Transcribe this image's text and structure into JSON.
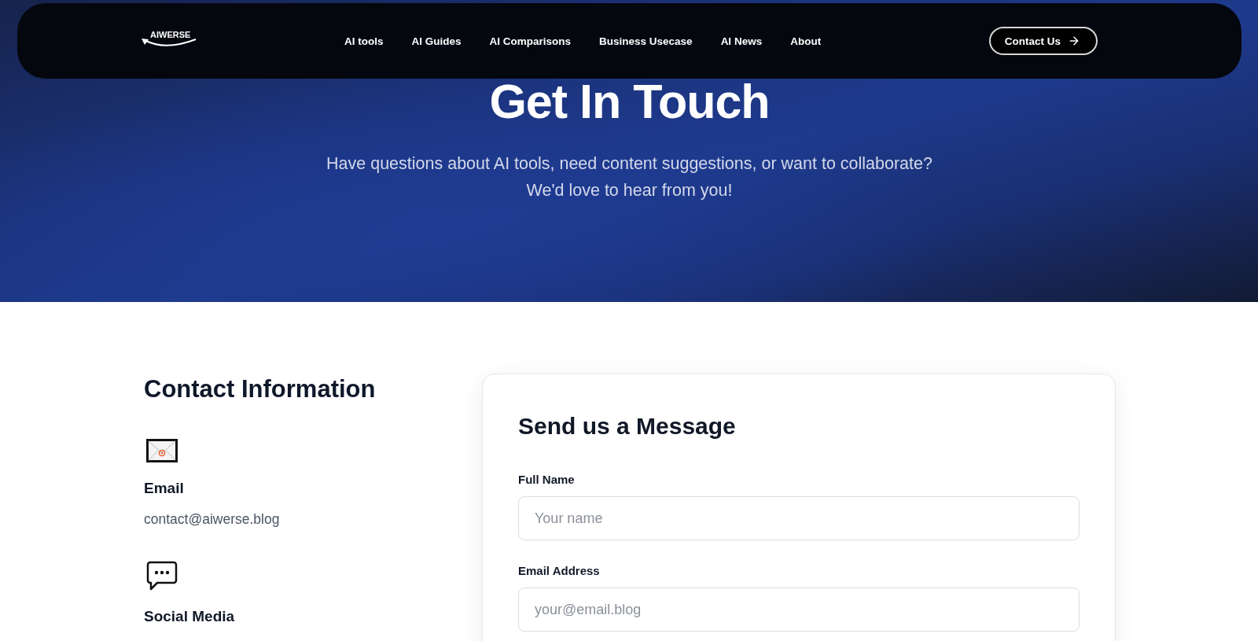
{
  "nav": {
    "logo": "AIWERSE",
    "links": [
      "AI tools",
      "AI Guides",
      "AI Comparisons",
      "Business Usecase",
      "AI News",
      "About"
    ],
    "cta": {
      "label": "Contact Us"
    }
  },
  "hero": {
    "title": "Get In Touch",
    "subtitle_lines": [
      "Have questions about AI tools, need content suggestions, or want to collaborate?",
      "We'd love to hear from you!"
    ]
  },
  "contact_info": {
    "title": "Contact Information",
    "items": [
      {
        "kind": "email",
        "label": "Email",
        "value": "contact@aiwerse.blog"
      },
      {
        "kind": "social",
        "label": "Social Media"
      }
    ]
  },
  "form": {
    "title": "Send us a Message",
    "fields": [
      {
        "label": "Full Name",
        "placeholder": "Your name"
      },
      {
        "label": "Email Address",
        "placeholder": "your@email.blog"
      }
    ]
  }
}
